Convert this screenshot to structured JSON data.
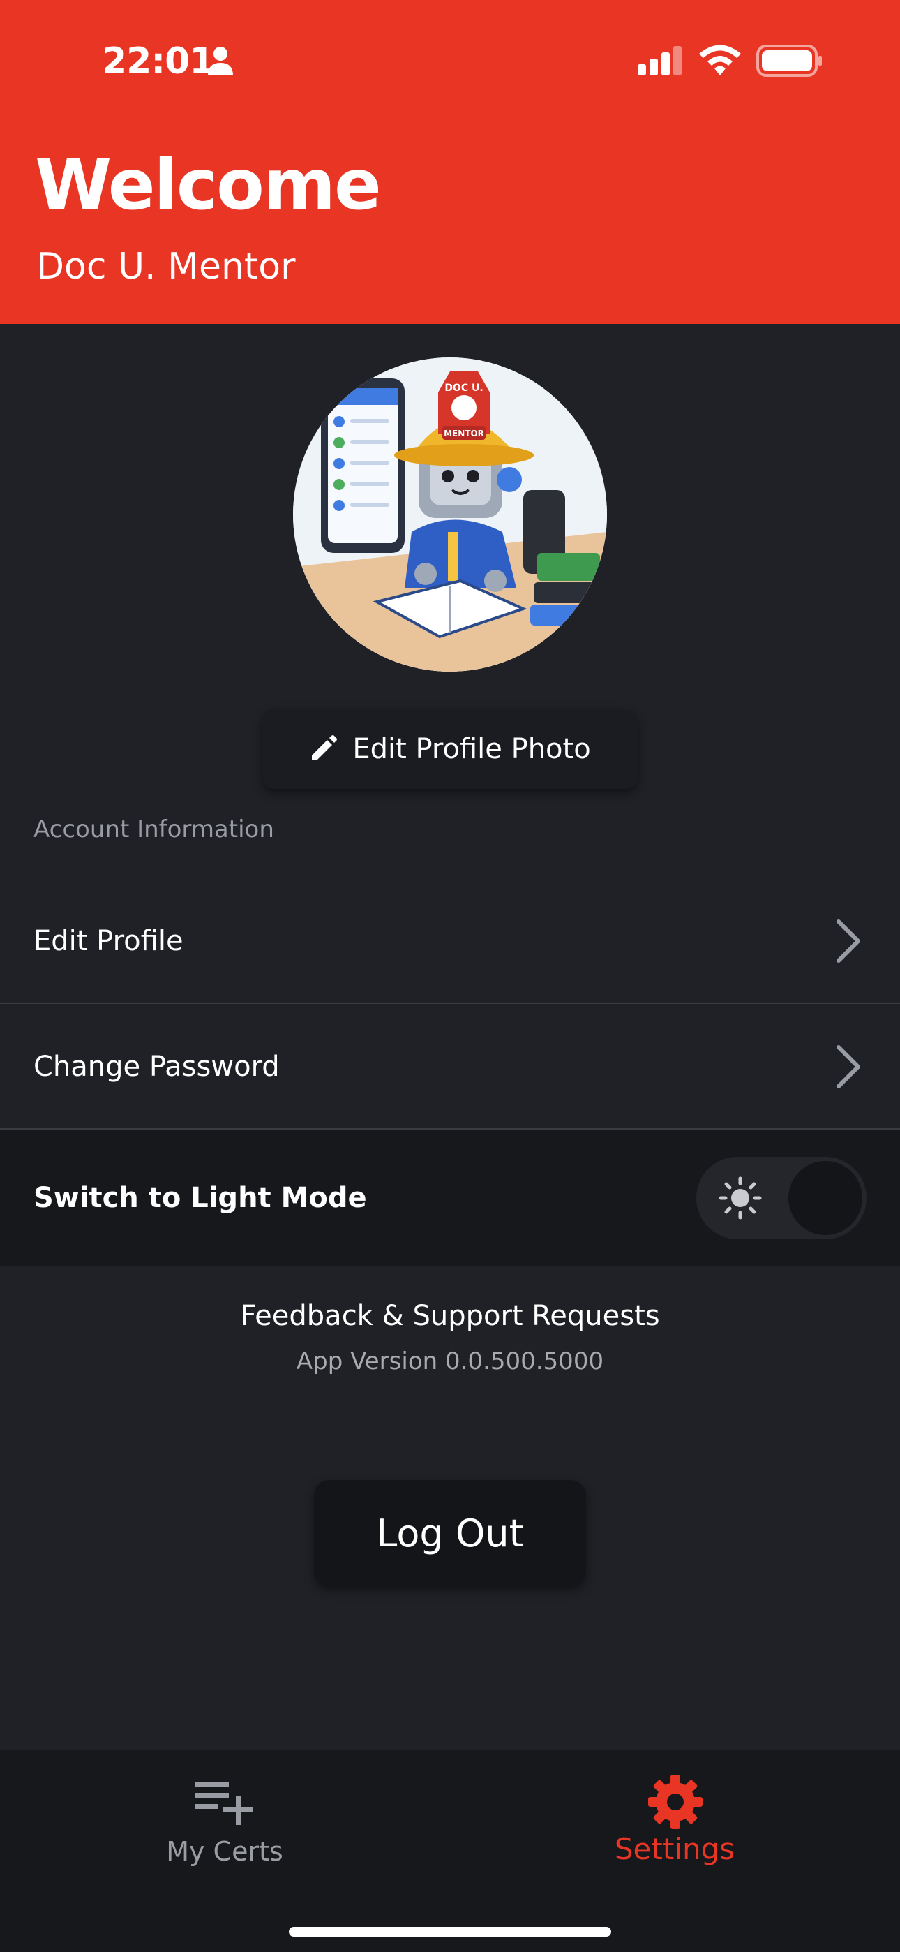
{
  "status_bar": {
    "time": "22:01"
  },
  "header": {
    "title": "Welcome",
    "subtitle": "Doc U. Mentor"
  },
  "profile": {
    "edit_photo_label": "Edit Profile Photo",
    "avatar_badge_text": "DOC U.",
    "avatar_hat_text": "MENTOR"
  },
  "account": {
    "section_label": "Account Information",
    "edit_profile": "Edit Profile",
    "change_password": "Change Password"
  },
  "appearance": {
    "light_mode_label": "Switch to Light Mode",
    "light_mode_enabled": false
  },
  "footer": {
    "feedback": "Feedback & Support Requests",
    "version": "App Version 0.0.500.5000"
  },
  "logout": {
    "label": "Log Out"
  },
  "tabs": [
    {
      "label": "My Certs",
      "icon": "playlist-add-icon",
      "active": false
    },
    {
      "label": "Settings",
      "icon": "gear-icon",
      "active": true
    }
  ],
  "colors": {
    "accent": "#e83524",
    "background": "#1f2126",
    "row_dark": "#17181c",
    "muted_text": "#9a9ca3"
  }
}
